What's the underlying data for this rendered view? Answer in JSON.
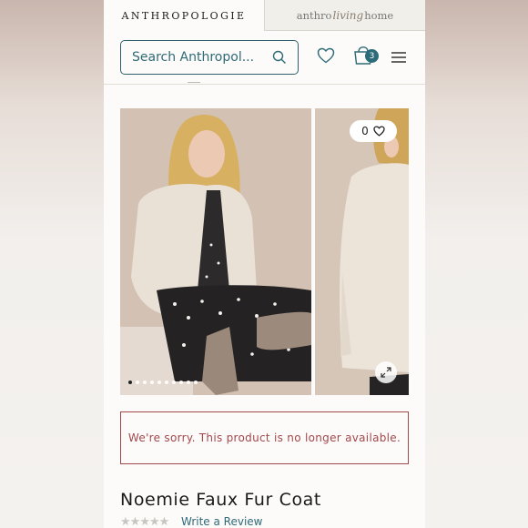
{
  "header": {
    "tab_primary": "ANTHROPOLOGIE",
    "tab_secondary_pre": "anthro",
    "tab_secondary_script": "living",
    "tab_secondary_post": "home"
  },
  "search": {
    "placeholder": "Search Anthropol..."
  },
  "cart": {
    "count": "3"
  },
  "gallery": {
    "favorites_count": "0",
    "slide_count": 10,
    "active_slide": 1
  },
  "product": {
    "unavailable_message": "We're sorry. This product is no longer available.",
    "name": "Noemie Faux Fur Coat",
    "rating_stars": 5,
    "write_review_label": "Write a Review"
  },
  "colors": {
    "accent": "#2f6a77",
    "alert": "#a2474c",
    "badge": "#2c6c79"
  }
}
